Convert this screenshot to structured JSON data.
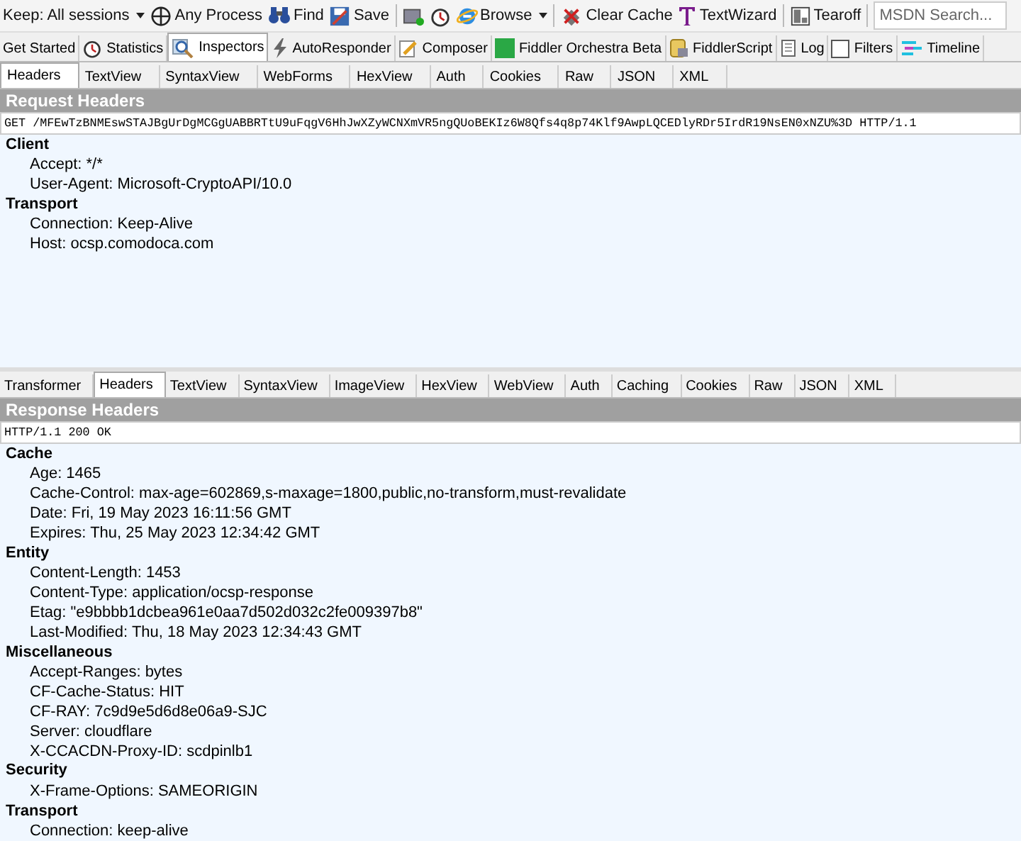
{
  "toolbar": {
    "items": [
      {
        "label": "Keep: All sessions",
        "dropdown": true
      },
      {
        "label": "Any Process",
        "dropdown": false
      },
      {
        "label": "Find",
        "dropdown": false
      },
      {
        "label": "Save",
        "dropdown": false
      },
      {
        "label": "Browse",
        "dropdown": true
      },
      {
        "label": "Clear Cache",
        "dropdown": false
      },
      {
        "label": "TextWizard",
        "dropdown": false
      },
      {
        "label": "Tearoff",
        "dropdown": false
      }
    ],
    "search": {
      "placeholder": "MSDN Search..."
    }
  },
  "main_tabs": [
    {
      "label": "Get Started",
      "selected": false
    },
    {
      "label": "Statistics",
      "selected": false
    },
    {
      "label": "Inspectors",
      "selected": true
    },
    {
      "label": "AutoResponder",
      "selected": false
    },
    {
      "label": "Composer",
      "selected": false
    },
    {
      "label": "Fiddler Orchestra Beta",
      "selected": false
    },
    {
      "label": "FiddlerScript",
      "selected": false
    },
    {
      "label": "Log",
      "selected": false
    },
    {
      "label": "Filters",
      "selected": false
    },
    {
      "label": "Timeline",
      "selected": false
    }
  ],
  "request": {
    "tabs": [
      {
        "label": "Headers",
        "selected": true
      },
      {
        "label": "TextView",
        "selected": false
      },
      {
        "label": "SyntaxView",
        "selected": false
      },
      {
        "label": "WebForms",
        "selected": false
      },
      {
        "label": "HexView",
        "selected": false
      },
      {
        "label": "Auth",
        "selected": false
      },
      {
        "label": "Cookies",
        "selected": false
      },
      {
        "label": "Raw",
        "selected": false
      },
      {
        "label": "JSON",
        "selected": false
      },
      {
        "label": "XML",
        "selected": false
      }
    ],
    "title": "Request Headers",
    "first_line": "GET /MFEwTzBNMEswSTAJBgUrDgMCGgUABBRTtU9uFqgV6HhJwXZyWCNXmVR5ngQUoBEKIz6W8Qfs4q8p74Klf9AwpLQCEDlyRDr5IrdR19NsEN0xNZU%3D HTTP/1.1",
    "groups": [
      {
        "name": "Client",
        "headers": [
          "Accept: */*",
          "User-Agent: Microsoft-CryptoAPI/10.0"
        ]
      },
      {
        "name": "Transport",
        "headers": [
          "Connection: Keep-Alive",
          "Host: ocsp.comodoca.com"
        ]
      }
    ]
  },
  "response": {
    "tabs": [
      {
        "label": "Transformer",
        "selected": false
      },
      {
        "label": "Headers",
        "selected": true
      },
      {
        "label": "TextView",
        "selected": false
      },
      {
        "label": "SyntaxView",
        "selected": false
      },
      {
        "label": "ImageView",
        "selected": false
      },
      {
        "label": "HexView",
        "selected": false
      },
      {
        "label": "WebView",
        "selected": false
      },
      {
        "label": "Auth",
        "selected": false
      },
      {
        "label": "Caching",
        "selected": false
      },
      {
        "label": "Cookies",
        "selected": false
      },
      {
        "label": "Raw",
        "selected": false
      },
      {
        "label": "JSON",
        "selected": false
      },
      {
        "label": "XML",
        "selected": false
      }
    ],
    "title": "Response Headers",
    "first_line": "HTTP/1.1 200 OK",
    "groups": [
      {
        "name": "Cache",
        "headers": [
          "Age: 1465",
          "Cache-Control: max-age=602869,s-maxage=1800,public,no-transform,must-revalidate",
          "Date: Fri, 19 May 2023 16:11:56 GMT",
          "Expires: Thu, 25 May 2023 12:34:42 GMT"
        ]
      },
      {
        "name": "Entity",
        "headers": [
          "Content-Length: 1453",
          "Content-Type: application/ocsp-response",
          "Etag: \"e9bbbb1dcbea961e0aa7d502d032c2fe009397b8\"",
          "Last-Modified: Thu, 18 May 2023 12:34:43 GMT"
        ]
      },
      {
        "name": "Miscellaneous",
        "headers": [
          "Accept-Ranges: bytes",
          "CF-Cache-Status: HIT",
          "CF-RAY: 7c9d9e5d6d8e06a9-SJC",
          "Server: cloudflare",
          "X-CCACDN-Proxy-ID: scdpinlb1"
        ]
      },
      {
        "name": "Security",
        "headers": [
          "X-Frame-Options: SAMEORIGIN"
        ]
      },
      {
        "name": "Transport",
        "headers": [
          "Connection: keep-alive"
        ]
      }
    ]
  }
}
